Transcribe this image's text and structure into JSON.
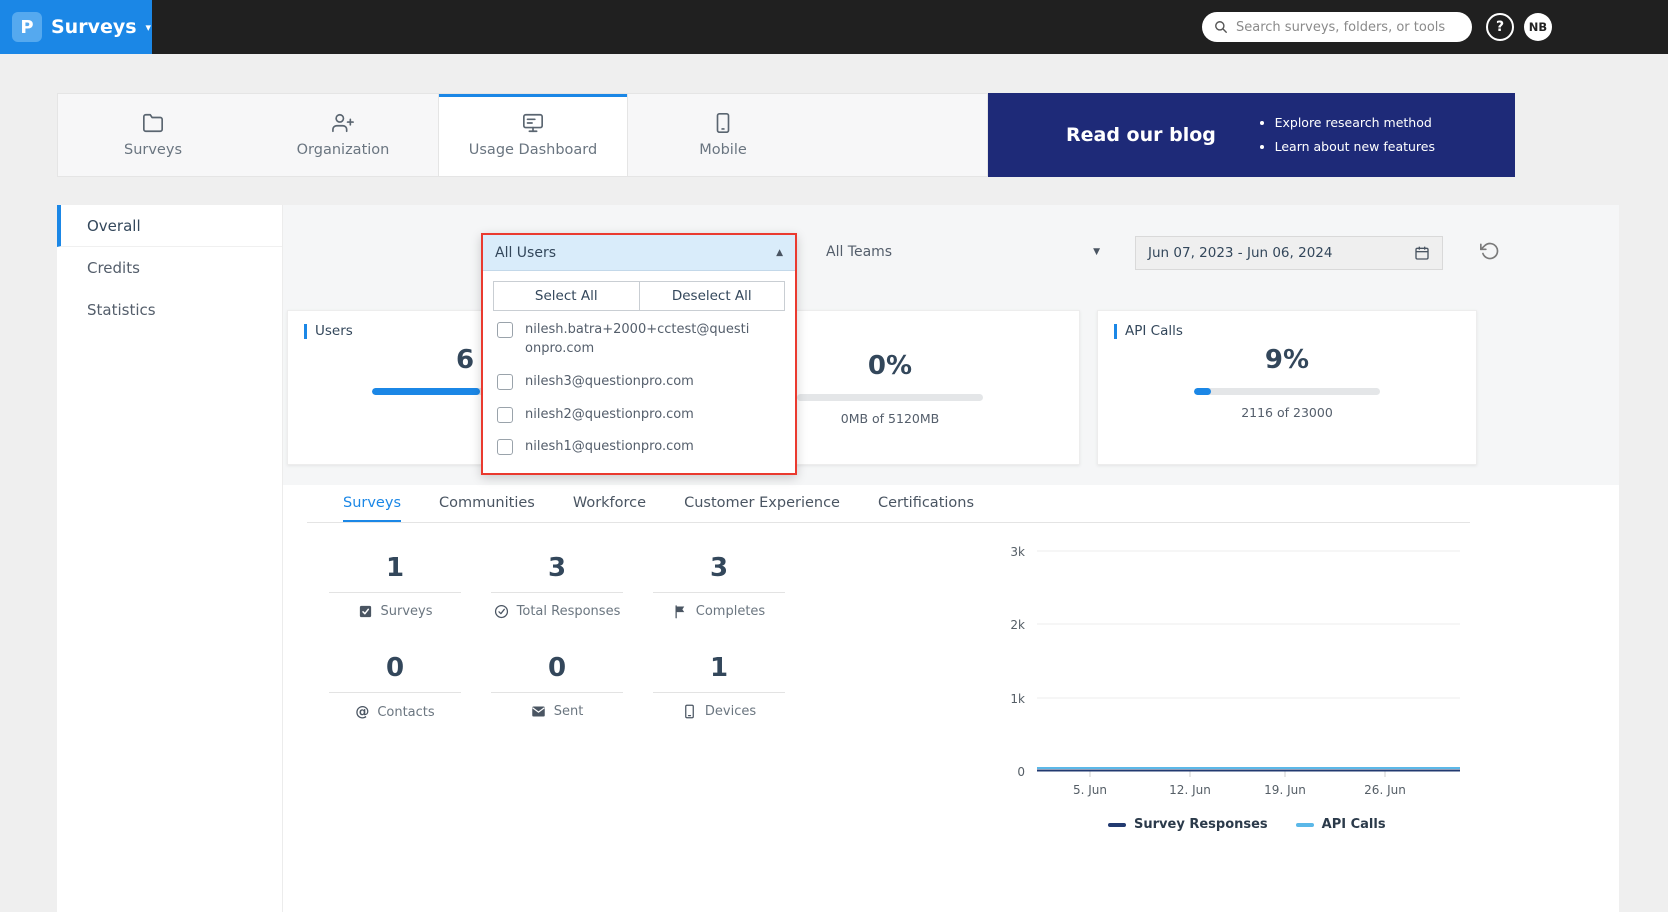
{
  "colors": {
    "accent_blue": "#1b87e6",
    "topbar_dark": "#202020",
    "banner_navy": "#1e2a78",
    "highlight_red": "#ea3a2f"
  },
  "topbar": {
    "logo_letter": "P",
    "product": "Surveys",
    "search_placeholder": "Search surveys, folders, or tools",
    "help_label": "?",
    "avatar_initials": "NB"
  },
  "nav": {
    "tabs": [
      {
        "label": "Surveys"
      },
      {
        "label": "Organization"
      },
      {
        "label": "Usage Dashboard"
      },
      {
        "label": "Mobile"
      }
    ],
    "banner": {
      "title": "Read our blog",
      "bullets": [
        "Explore research method",
        "Learn about new features"
      ]
    }
  },
  "sidebar": {
    "items": [
      {
        "label": "Overall"
      },
      {
        "label": "Credits"
      },
      {
        "label": "Statistics"
      }
    ]
  },
  "filters": {
    "users_dropdown": {
      "value": "All Users",
      "select_all": "Select All",
      "deselect_all": "Deselect All",
      "options": [
        "nilesh.batra+2000+cctest@questionpro.com",
        "nilesh3@questionpro.com",
        "nilesh2@questionpro.com",
        "nilesh1@questionpro.com"
      ]
    },
    "teams_dropdown": {
      "value": "All Teams"
    },
    "date_range": "Jun 07, 2023 - Jun 06, 2024"
  },
  "cards": {
    "users": {
      "title": "Users",
      "value": "6"
    },
    "storage": {
      "value": "0%",
      "sub": "0MB of 5120MB"
    },
    "api_calls": {
      "title": "API Calls",
      "value": "9%",
      "sub": "2116 of 23000"
    }
  },
  "content_tabs": [
    "Surveys",
    "Communities",
    "Workforce",
    "Customer Experience",
    "Certifications"
  ],
  "stats": [
    {
      "value": "1",
      "label": "Surveys"
    },
    {
      "value": "3",
      "label": "Total Responses"
    },
    {
      "value": "3",
      "label": "Completes"
    },
    {
      "value": "0",
      "label": "Contacts"
    },
    {
      "value": "0",
      "label": "Sent"
    },
    {
      "value": "1",
      "label": "Devices"
    }
  ],
  "chart_data": {
    "type": "line",
    "x": [
      "5. Jun",
      "12. Jun",
      "19. Jun",
      "26. Jun"
    ],
    "yticks": [
      "3k",
      "2k",
      "1k",
      "0"
    ],
    "ylim": [
      0,
      3000
    ],
    "grid": true,
    "legend_position": "bottom",
    "series": [
      {
        "name": "Survey Responses",
        "color": "#223a70",
        "values": [
          0,
          0,
          0,
          0
        ]
      },
      {
        "name": "API Calls",
        "color": "#5bb8e8",
        "values": [
          0,
          0,
          0,
          0
        ]
      }
    ]
  }
}
